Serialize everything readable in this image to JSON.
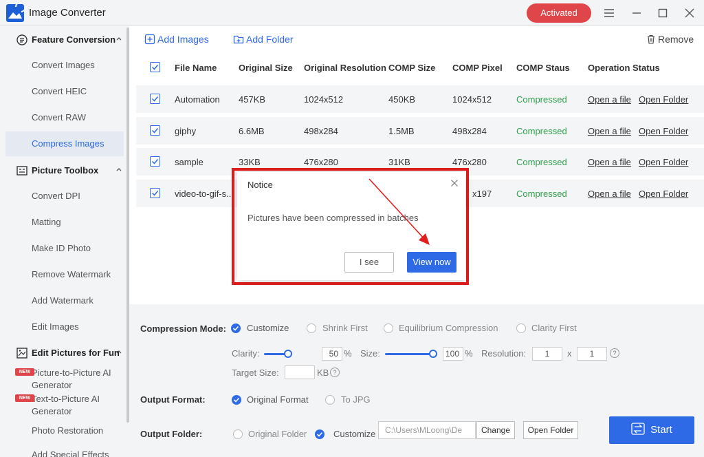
{
  "app": {
    "title": "Image Converter",
    "activated_label": "Activated"
  },
  "sidebar": {
    "groups": [
      {
        "label": "Feature Conversion",
        "items": [
          "Convert Images",
          "Convert HEIC",
          "Convert RAW",
          "Compress Images"
        ],
        "active": "Compress Images"
      },
      {
        "label": "Picture Toolbox",
        "items": [
          "Convert DPI",
          "Matting",
          "Make ID Photo",
          "Remove Watermark",
          "Add Watermark",
          "Edit Images"
        ]
      },
      {
        "label": "Edit Pictures for Fun",
        "items": [
          {
            "label": "Picture-to-Picture AI Generator",
            "badge": "NEW"
          },
          {
            "label": "Text-to-Picture AI Generator",
            "badge": "NEW"
          },
          {
            "label": "Photo Restoration"
          },
          {
            "label": "Add Special Effects"
          }
        ]
      }
    ]
  },
  "toolbar": {
    "add_images": "Add Images",
    "add_folder": "Add Folder",
    "remove": "Remove"
  },
  "table": {
    "columns": [
      "File Name",
      "Original Size",
      "Original Resolution",
      "COMP Size",
      "COMP Pixel",
      "COMP Staus",
      "Operation Status"
    ],
    "rows": [
      {
        "name": "Automation",
        "orig_size": "457KB",
        "orig_res": "1024x512",
        "comp_size": "450KB",
        "comp_pixel": "1024x512",
        "status": "Compressed",
        "open_file": "Open a file",
        "open_folder": "Open Folder"
      },
      {
        "name": "giphy",
        "orig_size": "6.6MB",
        "orig_res": "498x284",
        "comp_size": "1.5MB",
        "comp_pixel": "498x284",
        "status": "Compressed",
        "open_file": "Open a file",
        "open_folder": "Open Folder"
      },
      {
        "name": "sample",
        "orig_size": "33KB",
        "orig_res": "476x280",
        "comp_size": "31KB",
        "comp_pixel": "476x280",
        "status": "Compressed",
        "open_file": "Open a file",
        "open_folder": "Open Folder"
      },
      {
        "name": "video-to-gif-s...",
        "orig_size": "",
        "orig_res": "",
        "comp_size": "",
        "comp_pixel": "x197",
        "status": "Compressed",
        "open_file": "Open a file",
        "open_folder": "Open Folder"
      }
    ]
  },
  "settings": {
    "compression_mode": {
      "label": "Compression Mode:",
      "options": [
        "Customize",
        "Shrink First",
        "Equilibrium Compression",
        "Clarity First"
      ],
      "selected": "Customize"
    },
    "clarity": {
      "label": "Clarity:",
      "value": "50",
      "unit": "%",
      "level": 0.5
    },
    "size": {
      "label": "Size:",
      "value": "100",
      "unit": "%",
      "level": 1.0
    },
    "resolution": {
      "label": "Resolution:",
      "w": "1",
      "x": "x",
      "h": "1",
      "help": "?"
    },
    "target_size": {
      "label": "Target Size:",
      "value": "",
      "unit": "KB",
      "help": "?"
    },
    "output_format": {
      "label": "Output Format:",
      "options": [
        "Original Format",
        "To JPG"
      ],
      "selected": "Original Format"
    },
    "output_folder": {
      "label": "Output Folder:",
      "options": [
        "Original Folder",
        "Customize"
      ],
      "selected": "Customize",
      "path": "C:\\Users\\MLoong\\De",
      "change": "Change",
      "open_folder": "Open Folder"
    },
    "start": "Start"
  },
  "dialog": {
    "title": "Notice",
    "message": "Pictures have been compressed in batches",
    "i_see": "I see",
    "view_now": "View now"
  },
  "colors": {
    "accent": "#2e6ae6",
    "activated": "#e0454a",
    "compressed": "#2f9e4b",
    "highlight": "#e11d1d"
  }
}
